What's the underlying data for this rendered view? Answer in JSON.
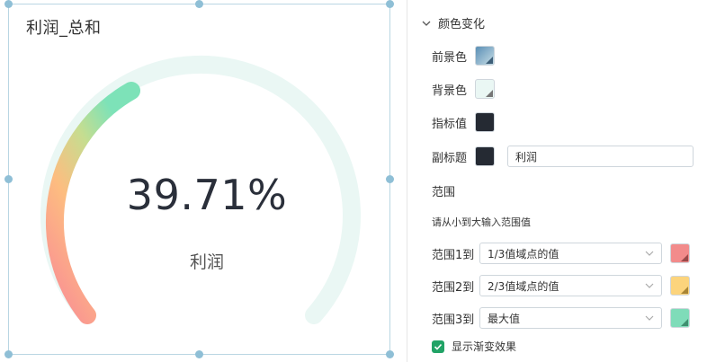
{
  "widget": {
    "title": "利润_总和",
    "value": "39.71%",
    "subtitle": "利润",
    "percent": 39.71
  },
  "panel": {
    "section_title": "颜色变化",
    "foreground_label": "前景色",
    "background_label": "背景色",
    "indicator_label": "指标值",
    "subtitle_label": "副标题",
    "subtitle_value": "利润",
    "range_title": "范围",
    "range_hint": "请从小到大输入范围值",
    "ranges": [
      {
        "label": "范围1到",
        "value": "1/3值域点的值",
        "color": "#f28b8b"
      },
      {
        "label": "范围2到",
        "value": "2/3值域点的值",
        "color": "#fcd47c"
      },
      {
        "label": "范围3到",
        "value": "最大值",
        "color": "#7fdcb9"
      }
    ],
    "gradient_label": "显示渐变效果",
    "colors": {
      "foreground_start": "#5a8fb5",
      "foreground_end": "#c7dde6",
      "background": "#eaf7f4",
      "indicator": "#252a33",
      "subtitle": "#252a33",
      "check": "#21a366"
    }
  }
}
